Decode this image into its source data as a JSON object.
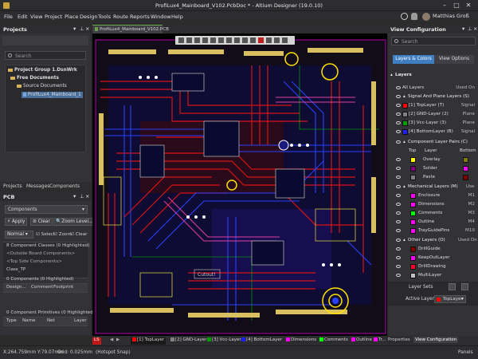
{
  "window": {
    "title": "ProfiLux4_Mainboard_V102.PcbDoc * - Altium Designer (19.0.10)",
    "user": "Matthias Groß"
  },
  "menu": [
    "File",
    "Edit",
    "View",
    "Project",
    "Place",
    "Design",
    "Tools",
    "Route",
    "Reports",
    "Window",
    "Help"
  ],
  "projects": {
    "title": "Projects",
    "search_placeholder": "Search",
    "tree": {
      "group": "Project Group 1.DsnWrk",
      "free_docs": "Free Documents",
      "source_docs": "Source Documents",
      "file": "ProfiLux4_Mainboard_1"
    },
    "tabs": [
      "Projects",
      "Messages",
      "Components"
    ]
  },
  "pcb_panel": {
    "title": "PCB",
    "mode": "Components",
    "apply": "Apply",
    "clear": "Clear",
    "zoom": "Zoom Level...",
    "filter_mode": "Normal",
    "options": [
      "Select",
      "Zoom",
      "Clear"
    ],
    "classes_header": "8 Component Classes (0 Highlighted)",
    "class_items": [
      "<Outside Board Components>",
      "<Top Side Components>",
      "Class_TP"
    ],
    "components_header": "0 Components (0 Highlighted)",
    "components_cols": [
      "Design...",
      "Comment",
      "Footprint"
    ],
    "primitives_header": "0 Component Primitives (0 Highlighted)",
    "primitives_cols": [
      "Type",
      "Name",
      "Net",
      "Layer"
    ]
  },
  "editor": {
    "doc_tab": "ProfiLux4_Mainboard_V102.PCB",
    "silk_label": "Cutout!"
  },
  "view_config": {
    "title": "View Configuration",
    "search_placeholder": "Search",
    "tabs": [
      "Layers & Colors",
      "View Options"
    ],
    "layers_header": "Layers",
    "all_layers": "All Layers",
    "used_on": "Used On",
    "signal_header": "Signal And Plane Layers (S)",
    "signal_layers": [
      {
        "name": "[1] TopLayer (T)",
        "code": "Signal",
        "color": "#ff0000"
      },
      {
        "name": "[2] GND-Layer (2)",
        "code": "Plane",
        "color": "#808080"
      },
      {
        "name": "[3] Vcc-Layer (3)",
        "code": "Plane",
        "color": "#00a000"
      },
      {
        "name": "[4] BottomLayer (B)",
        "code": "Signal",
        "color": "#1e1eff"
      }
    ],
    "pairs_header": "Component Layer Pairs (C)",
    "pairs_cols": [
      "Top",
      "Layer",
      "Bottom"
    ],
    "pairs": [
      {
        "name": "Overlay",
        "top": "#ffff00",
        "bottom": "#808000"
      },
      {
        "name": "Solder",
        "top": "#800080",
        "bottom": "#ff00ff"
      },
      {
        "name": "Paste",
        "top": "#808080",
        "bottom": "#800000"
      }
    ],
    "mech_header": "Mechanical Layers (M)",
    "mech_use": "Use",
    "mech_layers": [
      {
        "name": "Enclosure",
        "code": "M1",
        "color": "#ff00ff"
      },
      {
        "name": "Dimensions",
        "code": "M2",
        "color": "#ff00ff"
      },
      {
        "name": "Comments",
        "code": "M3",
        "color": "#00ff00"
      },
      {
        "name": "Outline",
        "code": "M4",
        "color": "#ff00ff"
      },
      {
        "name": "TrayGuidePins",
        "code": "M10",
        "color": "#ff00ff"
      }
    ],
    "other_header": "Other Layers (O)",
    "other_use": "Used On",
    "other_layers": [
      {
        "name": "DrillGuide",
        "color": "#800000"
      },
      {
        "name": "KeepOutLayer",
        "color": "#ff00ff"
      },
      {
        "name": "DrillDrawing",
        "color": "#ff002a"
      },
      {
        "name": "MultiLayer",
        "color": "#c0c0c0"
      }
    ],
    "layer_sets": "Layer Sets",
    "active_layer_label": "Active Layer",
    "active_layer": "TopLayer"
  },
  "layer_tabs": [
    {
      "label": "LS",
      "color": "#ff0000"
    },
    {
      "label": "[1] TopLayer",
      "color": "#ff0000"
    },
    {
      "label": "[2] GND-Layer",
      "color": "#808080"
    },
    {
      "label": "[3] Vcc-Layer",
      "color": "#00a000"
    },
    {
      "label": "[4] BottomLayer",
      "color": "#1e1eff"
    },
    {
      "label": "Dimensions",
      "color": "#ff00ff"
    },
    {
      "label": "Comments",
      "color": "#00ff00"
    },
    {
      "label": "Outline",
      "color": "#ff00ff"
    },
    {
      "label": "Tr...",
      "color": "#ff00ff"
    }
  ],
  "right_tabs": [
    "Properties",
    "View Configuration"
  ],
  "status": {
    "coords": "X:264.759mm Y:79.07mm",
    "grid": "Grid: 0.025mm",
    "snap": "(Hotspot Snap)",
    "panels": "Panels"
  }
}
